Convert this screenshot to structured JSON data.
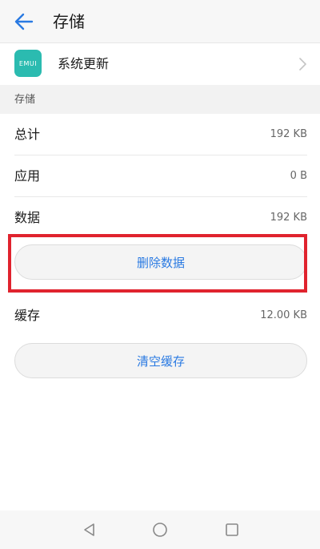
{
  "header": {
    "title": "存储",
    "back_icon": "arrow-left-icon"
  },
  "app": {
    "icon_text": "EMUI",
    "name": "系统更新",
    "icon_color": "#2bbbb0"
  },
  "storage_section": {
    "title": "存储",
    "rows": [
      {
        "label": "总计",
        "value": "192 KB"
      },
      {
        "label": "应用",
        "value": "0 B"
      },
      {
        "label": "数据",
        "value": "192 KB"
      }
    ],
    "clear_data_button": "删除数据"
  },
  "cache_section": {
    "label": "缓存",
    "value": "12.00 KB",
    "clear_cache_button": "清空缓存"
  },
  "navbar": {
    "items": [
      "back-triangle-icon",
      "home-circle-icon",
      "recents-square-icon"
    ]
  },
  "colors": {
    "accent": "#2a7ae2",
    "highlight": "#e0232e"
  }
}
